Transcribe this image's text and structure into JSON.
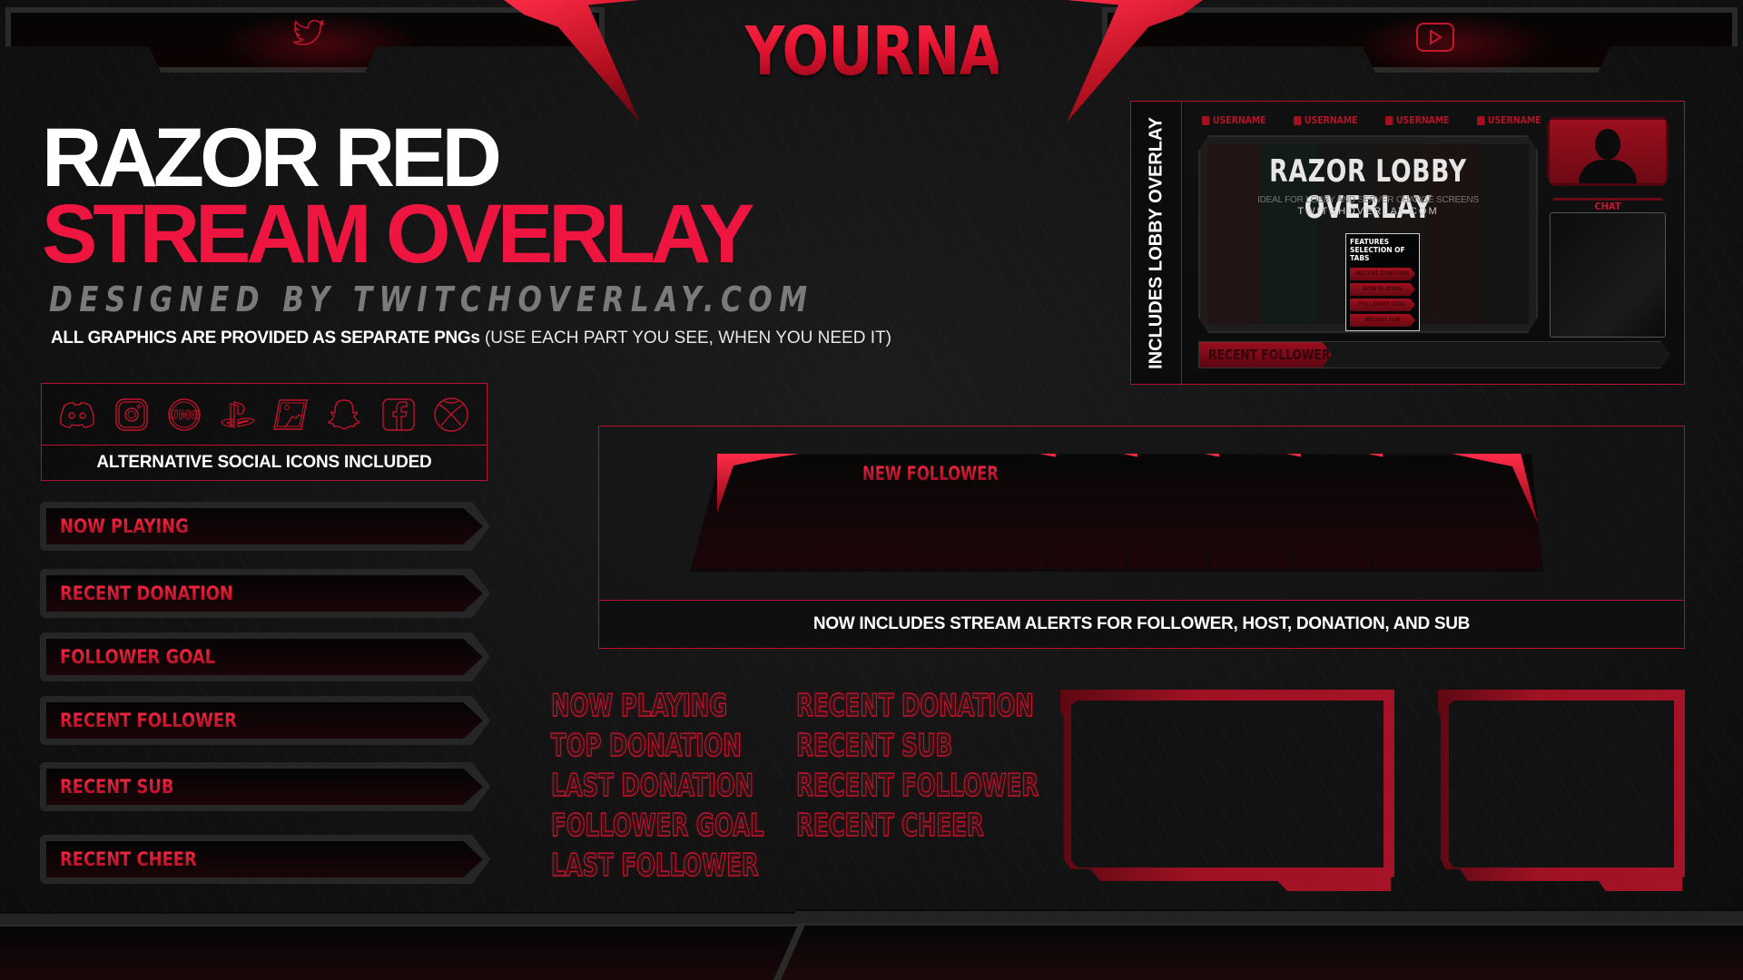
{
  "header": {
    "channel_name": "YOURNAME",
    "left_social_icon": "twitter-icon",
    "right_social_icon": "youtube-icon"
  },
  "title": {
    "line1": "RAZOR RED",
    "line2": "STREAM OVERLAY",
    "designed_by": "DESIGNED BY TWITCHOVERLAY.COM",
    "note_bold": "ALL GRAPHICS ARE PROVIDED AS SEPARATE PNGs",
    "note_light": " (USE EACH PART YOU SEE, WHEN YOU NEED IT)"
  },
  "social_icons": {
    "icons": [
      "discord-icon",
      "instagram-icon",
      "umg-icon",
      "playstation-icon",
      "esea-icon",
      "snapchat-icon",
      "facebook-icon",
      "xbox-icon"
    ],
    "caption": "ALTERNATIVE SOCIAL ICONS INCLUDED"
  },
  "tab_bars": [
    {
      "label": "NOW PLAYING"
    },
    {
      "label": "RECENT DONATION"
    },
    {
      "label": "FOLLOWER GOAL"
    },
    {
      "label": "RECENT FOLLOWER"
    },
    {
      "label": "RECENT SUB"
    },
    {
      "label": "RECENT CHEER"
    }
  ],
  "lobby": {
    "side_label": "INCLUDES LOBBY OVERLAY",
    "socials": [
      {
        "icon": "twitter-icon",
        "label": "USERNAME"
      },
      {
        "icon": "instagram-icon",
        "label": "USERNAME"
      },
      {
        "icon": "youtube-icon",
        "label": "USERNAME"
      },
      {
        "icon": "facebook-icon",
        "label": "USERNAME"
      }
    ],
    "title": "RAZOR LOBBY OVERLAY",
    "subtitle": "IDEAL FOR LOBBY AND SERVER CHANGE SCREENS",
    "url": "TWITCHOVERLAY.COM",
    "callout_title": "FEATURES SELECTION OF TABS",
    "callout_tabs": [
      "RECENT DONATION",
      "NOW PLAYING",
      "FOLLOWER GOAL",
      "RECENT SUB"
    ],
    "chat_label": "CHAT",
    "follower_label": "RECENT FOLLOWER"
  },
  "alerts": {
    "alert_label": "NEW FOLLOWER",
    "caption": "NOW INCLUDES STREAM ALERTS FOR FOLLOWER, HOST, DONATION, AND SUB"
  },
  "outline_labels": {
    "col1": [
      "NOW PLAYING",
      "TOP DONATION",
      "LAST DONATION",
      "FOLLOWER GOAL",
      "LAST FOLLOWER"
    ],
    "col2": [
      "RECENT DONATION",
      "RECENT SUB",
      "RECENT FOLLOWER",
      "RECENT CHEER"
    ]
  },
  "colors": {
    "accent_red": "#ee1540",
    "border_red": "#b5132b",
    "background": "#141414",
    "muted_gray": "#7a7a7a"
  }
}
